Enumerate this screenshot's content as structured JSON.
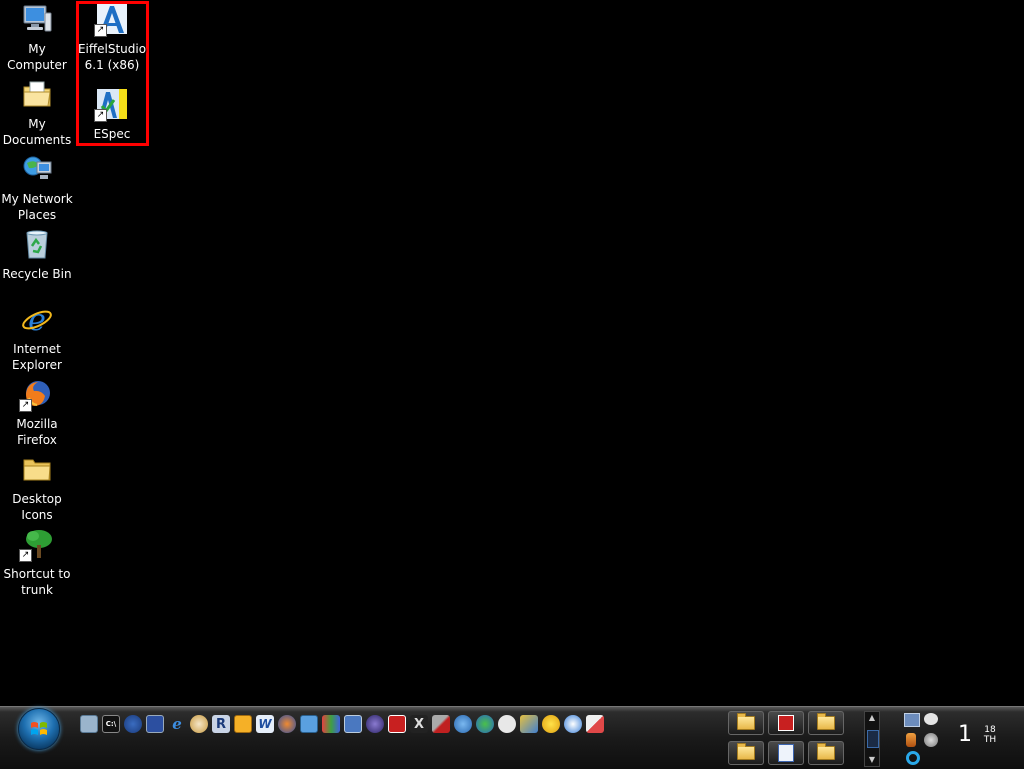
{
  "desktop": {
    "icons": [
      {
        "label": "My\nComputer",
        "icon": "computer-icon"
      },
      {
        "label": "My\nDocuments",
        "icon": "documents-folder-icon"
      },
      {
        "label": "My Network\nPlaces",
        "icon": "network-icon"
      },
      {
        "label": "Recycle Bin",
        "icon": "recycle-bin-icon"
      },
      {
        "label": "Internet\nExplorer",
        "icon": "internet-explorer-icon"
      },
      {
        "label": "Mozilla\nFirefox",
        "icon": "firefox-icon"
      },
      {
        "label": "Desktop\nIcons",
        "icon": "folder-icon"
      },
      {
        "label": "Shortcut to\ntrunk",
        "icon": "tree-icon"
      },
      {
        "label": "EiffelStudio\n6.1 (x86)",
        "icon": "eiffelstudio-icon"
      },
      {
        "label": "ESpec",
        "icon": "espec-icon"
      }
    ],
    "highlight_color": "#ff0000"
  },
  "taskbar": {
    "quick_launch": [
      {
        "icon": "notepad-icon"
      },
      {
        "icon": "command-prompt-icon",
        "text": "C:\\"
      },
      {
        "icon": "firefox-small-icon"
      },
      {
        "icon": "remote-desktop-icon"
      },
      {
        "icon": "internet-explorer-small-icon"
      },
      {
        "icon": "feather-icon"
      },
      {
        "icon": "r-icon",
        "text": "R"
      },
      {
        "icon": "clock-icon"
      },
      {
        "icon": "word-icon",
        "text": "W"
      },
      {
        "icon": "firefox-small-icon-2"
      },
      {
        "icon": "document-icon"
      },
      {
        "icon": "paint-icon"
      },
      {
        "icon": "network-small-icon"
      },
      {
        "icon": "eclipse-icon"
      },
      {
        "icon": "red-app-icon"
      },
      {
        "icon": "x-icon",
        "text": "X"
      },
      {
        "icon": "tools-icon"
      },
      {
        "icon": "gear-icon"
      },
      {
        "icon": "messenger-icon"
      },
      {
        "icon": "chat-bubble-icon"
      },
      {
        "icon": "pen-icon"
      },
      {
        "icon": "smiley-icon"
      },
      {
        "icon": "media-player-icon"
      },
      {
        "icon": "eraser-icon"
      }
    ],
    "task_buttons": [
      {
        "icon": "folder-icon"
      },
      {
        "icon": "red-app-icon"
      },
      {
        "icon": "folder-icon"
      },
      {
        "icon": "folder-icon"
      },
      {
        "icon": "word-document-icon"
      },
      {
        "icon": "folder-icon"
      }
    ],
    "tray_icons": [
      {
        "icon": "network-tray-icon"
      },
      {
        "icon": "chat-tray-icon"
      },
      {
        "icon": "bottle-tray-icon"
      },
      {
        "icon": "volume-tray-icon"
      },
      {
        "icon": "search-tray-icon"
      }
    ],
    "clock": {
      "main": "1",
      "superscript_top": "18",
      "superscript_bottom": "TH"
    }
  }
}
